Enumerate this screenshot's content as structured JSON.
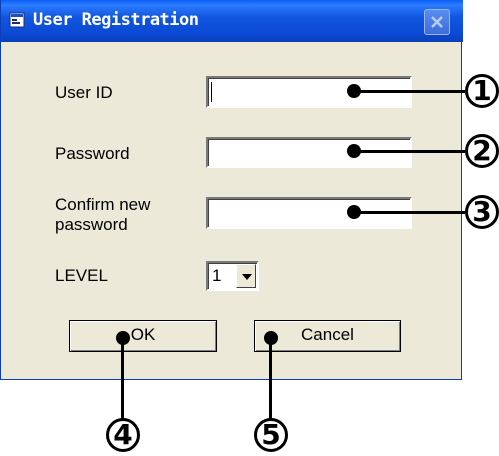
{
  "window": {
    "title": "User Registration"
  },
  "form": {
    "user_id_label": "User ID",
    "user_id_value": "",
    "password_label": "Password",
    "password_value": "",
    "confirm_label_line1": "Confirm new",
    "confirm_label_line2": "password",
    "confirm_value": "",
    "level_label": "LEVEL",
    "level_value": "1"
  },
  "buttons": {
    "ok_label": "OK",
    "cancel_label": "Cancel"
  },
  "callouts": {
    "user_id": "1",
    "password": "2",
    "confirm": "3",
    "ok": "4",
    "cancel": "5"
  },
  "colors": {
    "titlebar": "#0b49d4",
    "window_bg": "#ece9d8",
    "title_text": "#ffffff"
  }
}
